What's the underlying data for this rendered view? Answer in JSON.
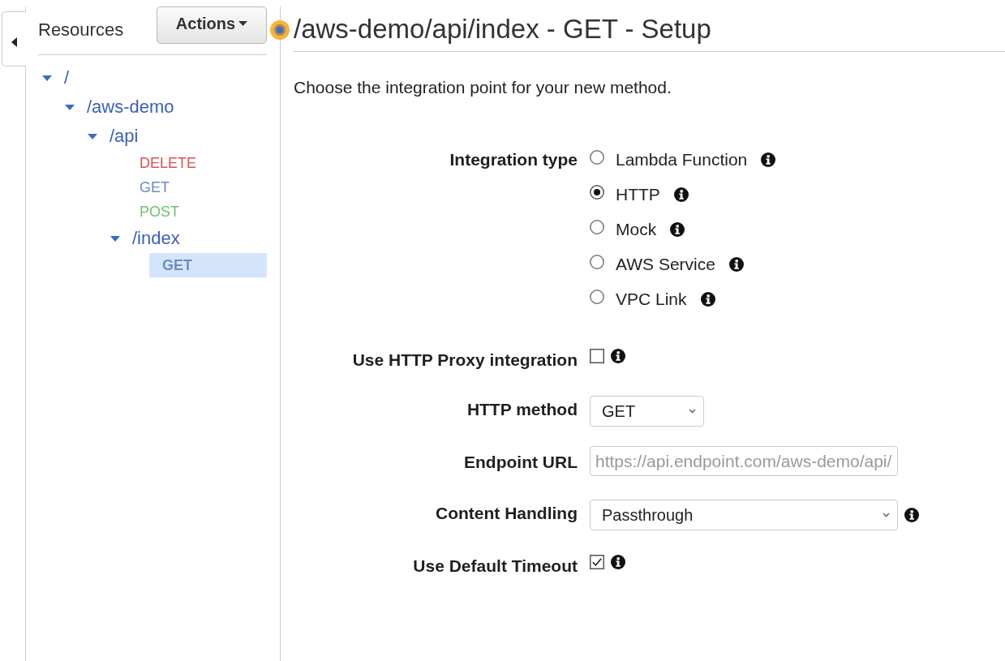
{
  "sidebar": {
    "title": "Resources",
    "actions_button": "Actions",
    "tree": [
      {
        "kind": "resource",
        "label": "/",
        "expanded": true,
        "selected": false,
        "children": [
          {
            "kind": "resource",
            "label": "/aws-demo",
            "expanded": true,
            "selected": false,
            "children": [
              {
                "kind": "resource",
                "label": "/api",
                "expanded": true,
                "selected": false,
                "children": [
                  {
                    "kind": "method",
                    "label": "DELETE",
                    "color": "#d9534f",
                    "selected": false
                  },
                  {
                    "kind": "method",
                    "label": "GET",
                    "color": "#6b8cc6",
                    "selected": false
                  },
                  {
                    "kind": "method",
                    "label": "POST",
                    "color": "#6cc36c",
                    "selected": false
                  },
                  {
                    "kind": "resource",
                    "label": "/index",
                    "expanded": true,
                    "selected": false,
                    "children": [
                      {
                        "kind": "method",
                        "label": "GET",
                        "color": "#6b8cc6",
                        "selected": true
                      }
                    ]
                  }
                ]
              }
            ]
          }
        ]
      }
    ]
  },
  "page": {
    "title": "/aws-demo/api/index - GET - Setup",
    "description": "Choose the integration point for your new method."
  },
  "form": {
    "integration_type": {
      "label": "Integration type",
      "options": [
        {
          "label": "Lambda Function",
          "selected": false,
          "info": true
        },
        {
          "label": "HTTP",
          "selected": true,
          "info": true
        },
        {
          "label": "Mock",
          "selected": false,
          "info": true
        },
        {
          "label": "AWS Service",
          "selected": false,
          "info": true
        },
        {
          "label": "VPC Link",
          "selected": false,
          "info": true
        }
      ]
    },
    "fields": [
      {
        "kind": "checkbox",
        "label": "Use HTTP Proxy integration",
        "checked": false,
        "info": true
      },
      {
        "kind": "select",
        "label": "HTTP method",
        "value": "GET",
        "info": false
      },
      {
        "kind": "input",
        "label": "Endpoint URL",
        "placeholder": "https://api.endpoint.com/aws-demo/api/",
        "info": false
      },
      {
        "kind": "select",
        "label": "Content Handling",
        "value": "Passthrough",
        "info": true
      },
      {
        "kind": "checkbox",
        "label": "Use Default Timeout",
        "checked": true,
        "info": true
      }
    ]
  }
}
